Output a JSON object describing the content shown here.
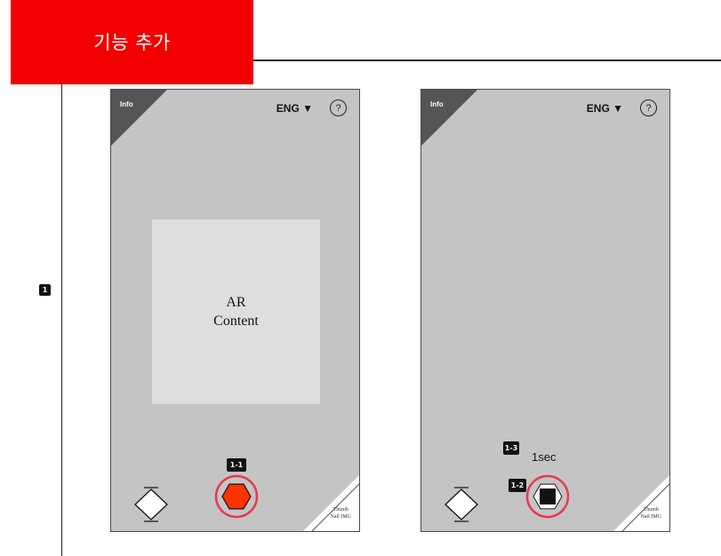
{
  "header": {
    "title": "기능 추가"
  },
  "step": {
    "label": "1"
  },
  "phone_left": {
    "info_label": "Info",
    "lang_label": "ENG ▼",
    "help_label": "?",
    "ar_content_line1": "AR",
    "ar_content_line2": "Content",
    "capture_badge": "1-1",
    "thumb_line1": "Thumb",
    "thumb_line2": "Nail IMG",
    "colors": {
      "capture_ring": "#e8394a",
      "capture_fill": "#ff3300"
    }
  },
  "phone_right": {
    "info_label": "Info",
    "lang_label": "ENG ▼",
    "help_label": "?",
    "timer_badge": "1-3",
    "timer_text": "1sec",
    "stop_badge": "1-2",
    "thumb_line1": "Thumb",
    "thumb_line2": "Nail IMG",
    "colors": {
      "stop_ring": "#e8394a"
    }
  },
  "colors": {
    "accent": "#f20000",
    "phone_bg": "#c4c4c4",
    "ar_box_bg": "#dedede",
    "corner_bg": "#555555"
  },
  "icons": {
    "switch": "diamond-switch-icon",
    "capture": "hexagon-capture-icon",
    "stop": "stop-square-icon",
    "help": "question-circle-icon"
  }
}
